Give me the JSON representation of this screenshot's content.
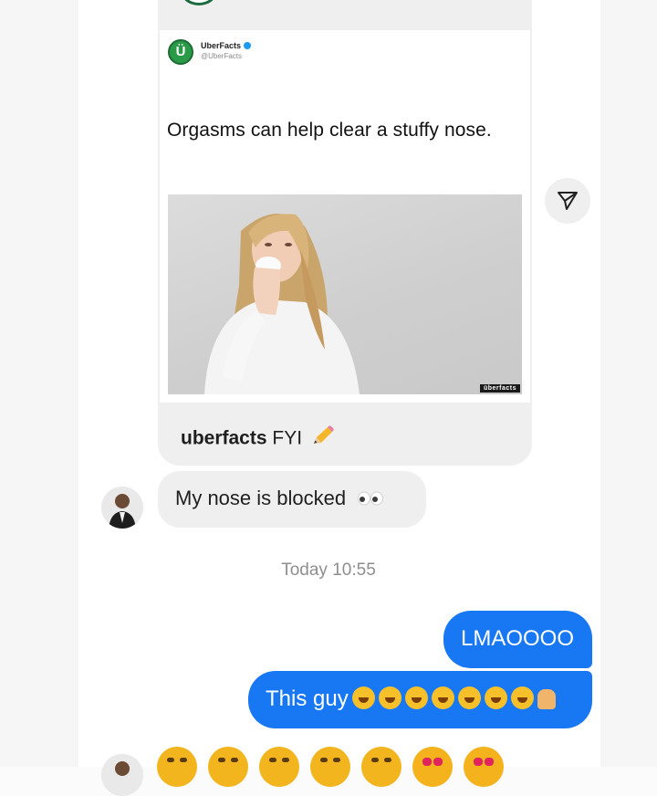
{
  "shared_post": {
    "source_name": "UberFacts",
    "source_handle": "@UberFacts",
    "logo_letter": "Ü",
    "tweet_text": "Orgasms can help clear a stuffy nose.",
    "photo_watermark": "überfacts",
    "caption_user": "uberfacts",
    "caption_text": "FYI",
    "caption_emoji": "pencil-icon"
  },
  "messages": [
    {
      "id": "m1",
      "direction": "incoming",
      "text": "My nose is blocked",
      "emoji": "eyes-icon"
    },
    {
      "id": "m2",
      "direction": "outgoing",
      "text": "LMAOOOO"
    },
    {
      "id": "m3",
      "direction": "outgoing",
      "text": "This guy",
      "emoji_count": 7,
      "trailing_emoji": "raised-hands-icon"
    }
  ],
  "timestamp": "Today 10:55",
  "colors": {
    "outgoing_bubble": "#1877f2",
    "incoming_bubble": "#efefef",
    "logo_green": "#2a9a49"
  }
}
